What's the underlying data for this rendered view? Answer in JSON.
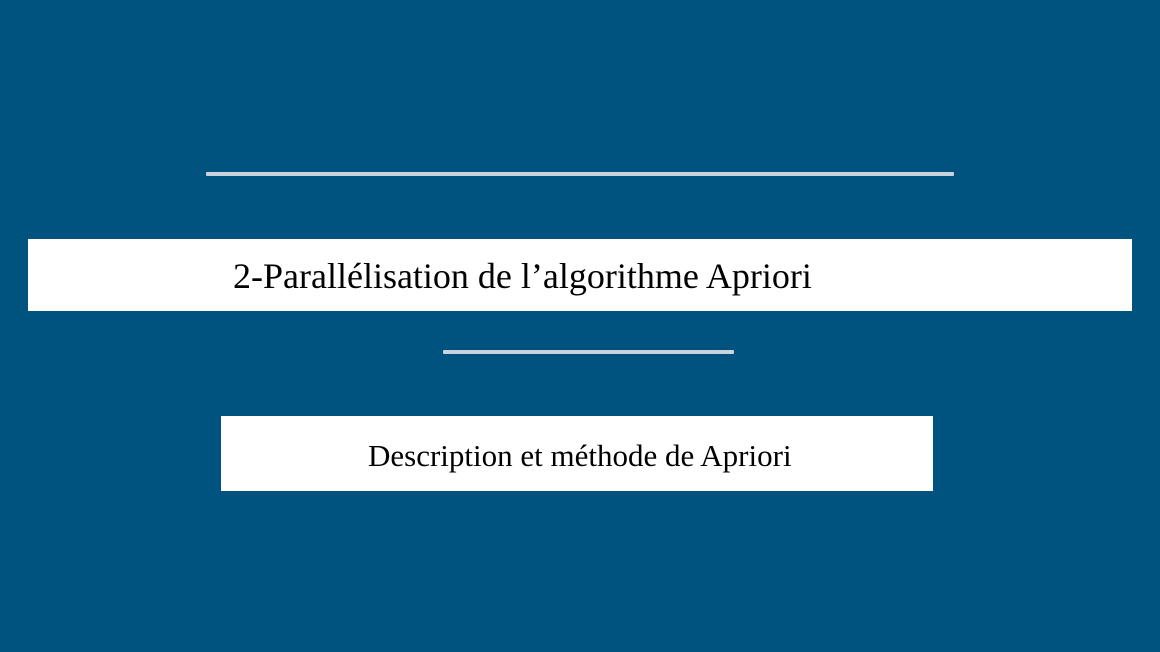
{
  "slide": {
    "title": "2-Parallélisation de l’algorithme Apriori",
    "subtitle": "Description et méthode de Apriori"
  },
  "colors": {
    "background": "#00527f",
    "rule": "#c9d3de",
    "banner": "#ffffff",
    "text": "#000000"
  }
}
